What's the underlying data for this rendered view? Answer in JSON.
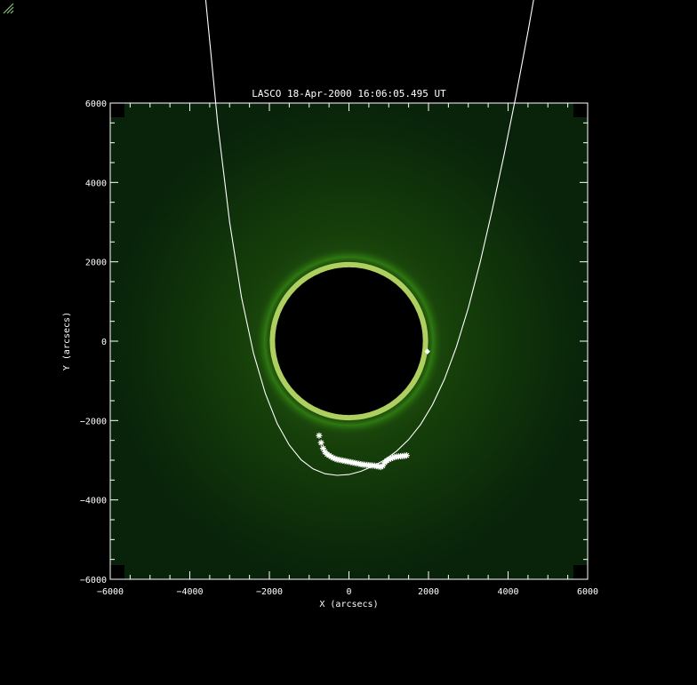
{
  "chart_data": {
    "type": "scatter",
    "title": "LASCO 18-Apr-2000 16:06:05.495 UT",
    "xlabel": "X (arcsecs)",
    "ylabel": "Y (arcsecs)",
    "xlim": [
      -6000,
      6000
    ],
    "ylim": [
      -6000,
      6000
    ],
    "xticks": [
      -6000,
      -4000,
      -2000,
      0,
      2000,
      4000,
      6000
    ],
    "yticks": [
      -6000,
      -4000,
      -2000,
      0,
      2000,
      4000,
      6000
    ],
    "xtick_labels": [
      "−6000",
      "−4000",
      "−2000",
      "0",
      "2000",
      "4000",
      "6000"
    ],
    "ytick_labels": [
      "−6000",
      "−4000",
      "−2000",
      "0",
      "2000",
      "4000",
      "6000"
    ],
    "grid": false,
    "background": "coronagraph image (green)",
    "occulter_radius": 1950,
    "series": [
      {
        "kind": "curve",
        "color": "#ffffff",
        "x": [
          -3600,
          -3300,
          -3000,
          -2700,
          -2400,
          -2100,
          -1800,
          -1500,
          -1200,
          -900,
          -600,
          -300,
          0,
          300,
          600,
          900,
          1200,
          1500,
          1800,
          2100,
          2400,
          2700,
          3000,
          3300,
          3600,
          3900,
          4200,
          4500,
          4800,
          5100,
          5400,
          5700,
          5900
        ],
        "y": [
          8600,
          5500,
          3000,
          1100,
          -300,
          -1320,
          -2080,
          -2620,
          -2990,
          -3220,
          -3340,
          -3380,
          -3360,
          -3280,
          -3150,
          -2990,
          -2770,
          -2480,
          -2100,
          -1600,
          -960,
          -150,
          840,
          2000,
          3300,
          4700,
          6200,
          7800,
          9500,
          11300,
          13200,
          15200,
          16600
        ]
      },
      {
        "kind": "points",
        "marker": "star",
        "color": "#ffffff",
        "x": [
          -750,
          -700,
          -650,
          -600,
          -550,
          -500,
          -450,
          -400,
          -350,
          -300,
          -250,
          -200,
          -150,
          -100,
          -50,
          0,
          50,
          100,
          150,
          200,
          250,
          300,
          350,
          400,
          450,
          500,
          550,
          600,
          650,
          700,
          750,
          800,
          850,
          900,
          950,
          1000,
          1050,
          1100,
          1150,
          1200,
          1250,
          1300,
          1350,
          1400,
          1450
        ],
        "y": [
          -2380,
          -2560,
          -2700,
          -2790,
          -2850,
          -2880,
          -2910,
          -2940,
          -2960,
          -2980,
          -2990,
          -3000,
          -3010,
          -3020,
          -3030,
          -3040,
          -3050,
          -3060,
          -3070,
          -3080,
          -3090,
          -3100,
          -3110,
          -3115,
          -3120,
          -3125,
          -3130,
          -3135,
          -3140,
          -3150,
          -3160,
          -3170,
          -3140,
          -3060,
          -3010,
          -2980,
          -2960,
          -2940,
          -2920,
          -2910,
          -2905,
          -2900,
          -2895,
          -2890,
          -2880
        ]
      },
      {
        "kind": "points",
        "marker": "diamond",
        "color": "#ffffff",
        "x": [
          1970
        ],
        "y": [
          -260
        ]
      }
    ]
  }
}
